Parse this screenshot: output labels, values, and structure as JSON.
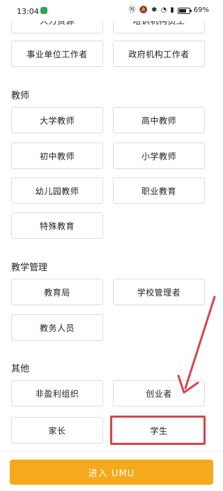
{
  "status_bar": {
    "time": "13:04",
    "battery": "69%",
    "icons": [
      "nfc-icon",
      "mute-icon",
      "bluetooth-icon",
      "wifi-icon",
      "signal-icon",
      "battery-icon"
    ]
  },
  "top_partial": {
    "left": "人力资源",
    "right": "培训机构员工"
  },
  "row_public": {
    "left": "事业单位工作者",
    "right": "政府机构工作者"
  },
  "sections": {
    "teacher": {
      "title": "教师",
      "items": [
        "大学教师",
        "高中教师",
        "初中教师",
        "小学教师",
        "幼儿园教师",
        "职业教育",
        "特殊教育"
      ]
    },
    "edu_admin": {
      "title": "教学管理",
      "items": [
        "教育局",
        "学校管理者",
        "教务人员"
      ]
    },
    "other": {
      "title": "其他",
      "items": [
        "非盈利组织",
        "创业者",
        "家长",
        "学生"
      ]
    }
  },
  "bottom": {
    "enter_label": "进入 UMU"
  },
  "colors": {
    "accent": "#f5a91c",
    "annotation": "#d9434a"
  }
}
